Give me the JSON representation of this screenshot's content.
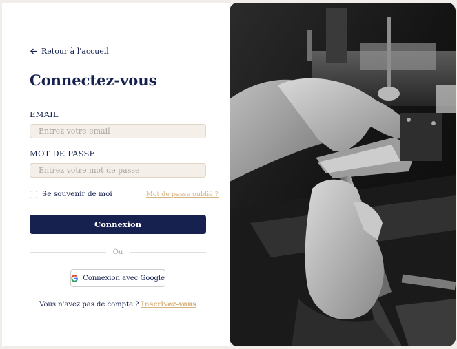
{
  "login": {
    "back_label": "Retour à l'accueil",
    "title": "Connectez-vous",
    "email_label": "EMAIL",
    "email_placeholder": "Entrez votre email",
    "email_value": "",
    "password_label": "MOT DE PASSE",
    "password_placeholder": "Entrez votre mot de passe",
    "password_value": "",
    "remember_label": "Se souvenir de moi",
    "forgot_label": "Mot de passe oublié ?",
    "submit_label": "Connexion",
    "divider_label": "Ou",
    "google_label": "Connexion avec Google",
    "signup_prompt": "Vous n'avez pas de compte ?",
    "signup_link": "Inscrivez-vous"
  },
  "icons": {
    "back": "arrow-left-icon",
    "google": "google-logo-icon"
  },
  "colors": {
    "primary": "#16214f",
    "accent": "#d6b383",
    "input_bg": "#f4efe9"
  }
}
